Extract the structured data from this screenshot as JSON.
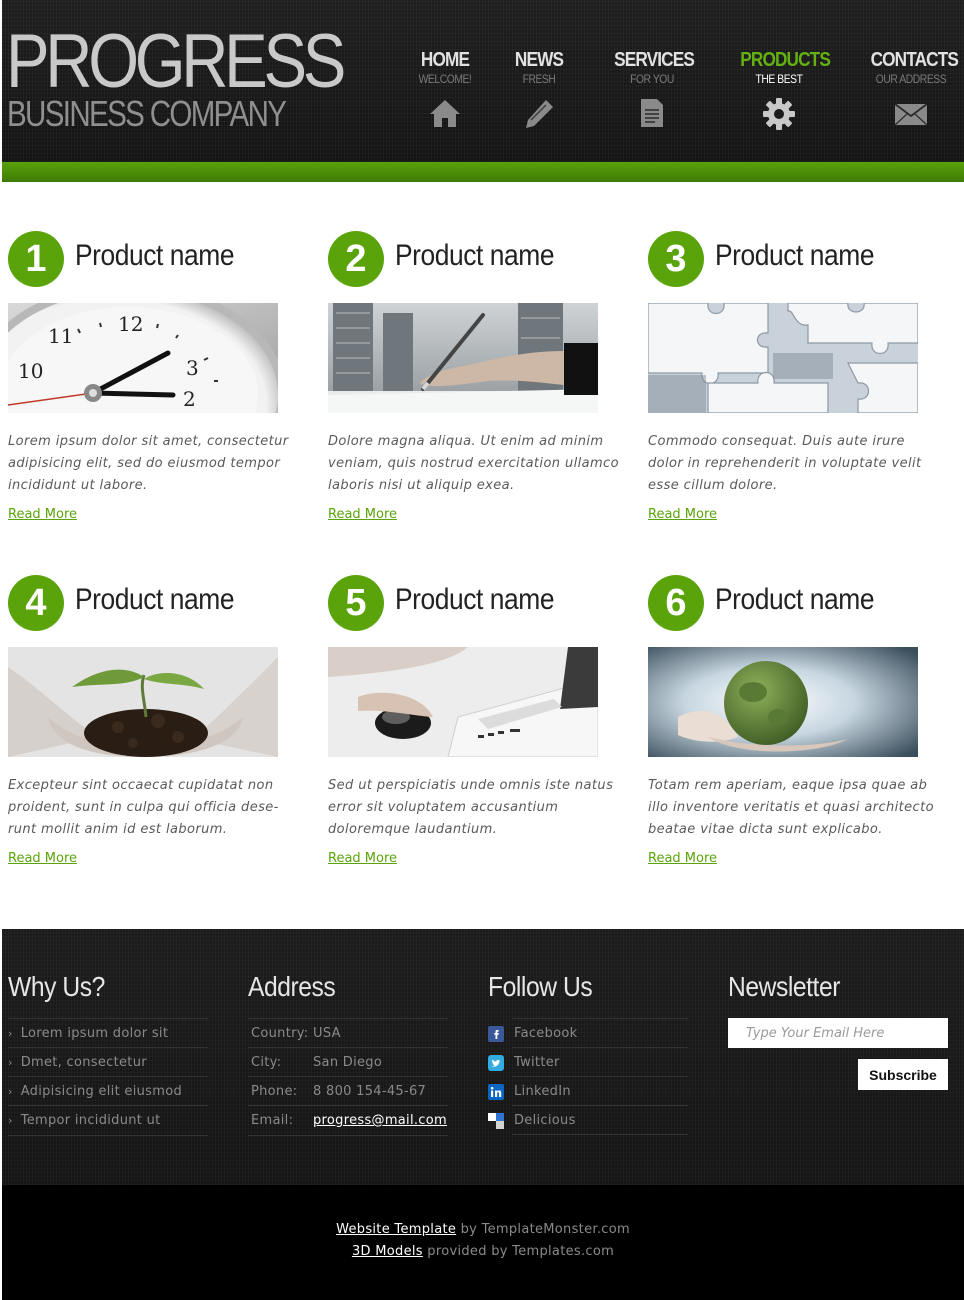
{
  "brand": {
    "title": "PROGRESS",
    "subtitle": "BUSINESS COMPANY"
  },
  "nav": [
    {
      "label": "HOME",
      "sub": "WELCOME!",
      "icon": "home-icon"
    },
    {
      "label": "NEWS",
      "sub": "FRESH",
      "icon": "pencil-icon"
    },
    {
      "label": "SERVICES",
      "sub": "FOR YOU",
      "icon": "document-icon"
    },
    {
      "label": "PRODUCTS",
      "sub": "THE BEST",
      "icon": "gear-icon",
      "active": true
    },
    {
      "label": "CONTACTS",
      "sub": "OUR ADDRESS",
      "icon": "envelope-icon"
    }
  ],
  "colors": {
    "accent": "#5aa30b",
    "header_bg": "#1a1a1a",
    "footer_bg": "#181818"
  },
  "products": [
    {
      "number": "1",
      "name": "Product name",
      "image": "clock-photo",
      "text": "Lorem ipsum dolor sit amet, consectetur adipisicing elit, sed do eiusmod tempor incididunt ut labore.",
      "link": "Read More"
    },
    {
      "number": "2",
      "name": "Product name",
      "image": "pen-writing-photo",
      "text": "Dolore magna aliqua. Ut enim ad minim veniam, quis nostrud exercitation ullamco laboris nisi ut aliquip exea.",
      "link": "Read More"
    },
    {
      "number": "3",
      "name": "Product name",
      "image": "puzzle-photo",
      "text": "Commodo consequat. Duis aute irure dolor in reprehenderit in voluptate velit esse cillum dolore.",
      "link": "Read More"
    },
    {
      "number": "4",
      "name": "Product name",
      "image": "seedling-photo",
      "text": "Excepteur sint occaecat cupidatat non proident, sunt in culpa qui officia dese-runt mollit anim id est laborum.",
      "link": "Read More"
    },
    {
      "number": "5",
      "name": "Product name",
      "image": "laptop-mouse-photo",
      "text": "Sed ut perspiciatis unde omnis iste natus error sit voluptatem accusantium doloremque laudantium.",
      "link": "Read More"
    },
    {
      "number": "6",
      "name": "Product name",
      "image": "green-globe-photo",
      "text": "Totam rem aperiam, eaque ipsa quae ab illo inventore veritatis et quasi architecto beatae vitae dicta sunt explicabo.",
      "link": "Read More"
    }
  ],
  "footer": {
    "why": {
      "title": "Why Us?",
      "items": [
        "Lorem ipsum dolor sit",
        "Dmet, consectetur",
        "Adipisicing elit eiusmod",
        "Tempor incididunt ut"
      ]
    },
    "address": {
      "title": "Address",
      "rows": [
        {
          "label": "Country:",
          "value": "USA"
        },
        {
          "label": "City:",
          "value": "San Diego"
        },
        {
          "label": "Phone:",
          "value": "8 800 154-45-67"
        },
        {
          "label": "Email:",
          "value": "progress@mail.com"
        }
      ]
    },
    "follow": {
      "title": "Follow Us",
      "items": [
        {
          "label": "Facebook",
          "icon": "facebook-icon",
          "color": "#3b5998"
        },
        {
          "label": "Twitter",
          "icon": "twitter-icon",
          "color": "#33aae0"
        },
        {
          "label": "LinkedIn",
          "icon": "linkedin-icon",
          "color": "#0a66c2"
        },
        {
          "label": "Delicious",
          "icon": "delicious-icon",
          "color": "#3274d1"
        }
      ]
    },
    "newsletter": {
      "title": "Newsletter",
      "placeholder": "Type Your Email Here",
      "button": "Subscribe"
    }
  },
  "credits": {
    "line1_link": "Website Template",
    "line1_text": " by TemplateMonster.com",
    "line2_link": "3D Models",
    "line2_text": " provided by Templates.com"
  }
}
